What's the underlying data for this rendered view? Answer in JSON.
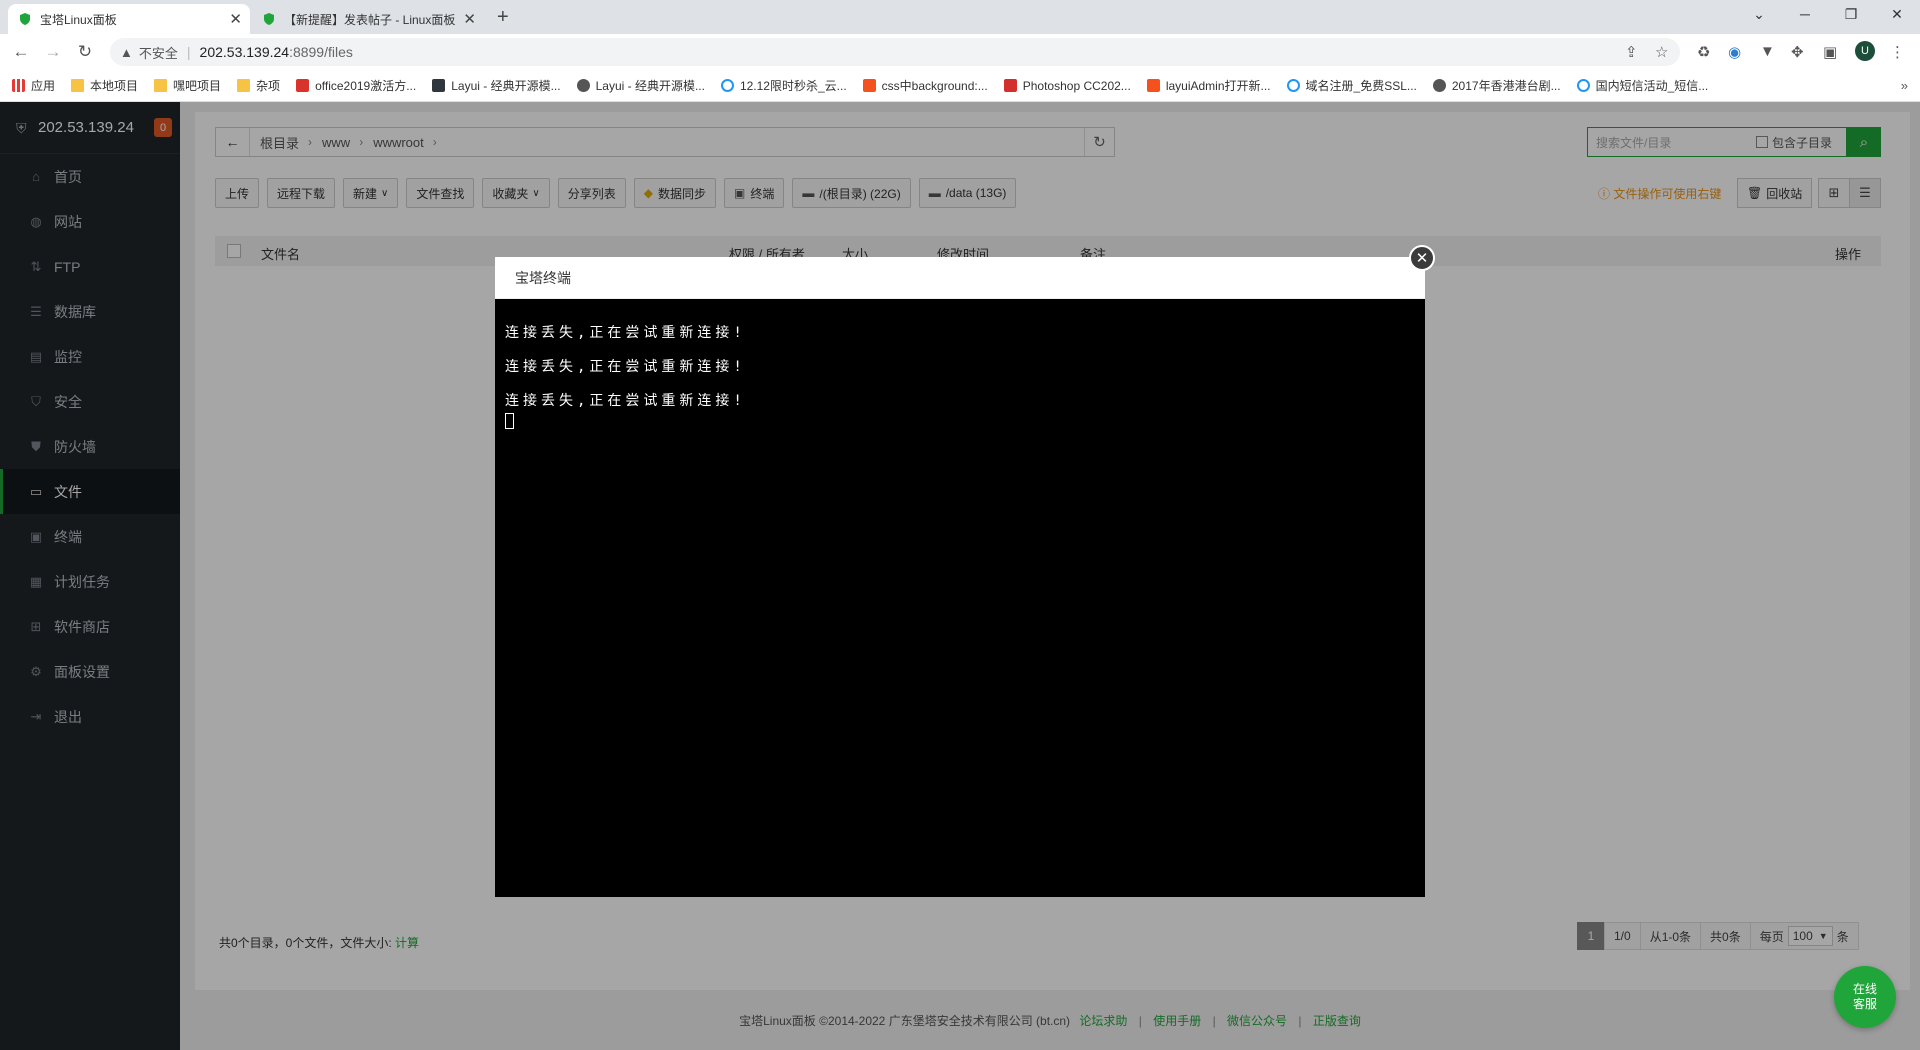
{
  "browser": {
    "tabs": [
      {
        "title": "宝塔Linux面板",
        "active": true
      },
      {
        "title": "【新提醒】发表帖子 - Linux面板",
        "active": false
      }
    ],
    "address": {
      "security_label": "不安全",
      "host": "202.53.139.24",
      "path": ":8899/files"
    },
    "avatar_letter": "U",
    "bookmarks": [
      "应用",
      "本地项目",
      "嘿吧项目",
      "杂项",
      "office2019激活方...",
      "Layui - 经典开源模...",
      "Layui - 经典开源模...",
      "12.12限时秒杀_云...",
      "css中background:...",
      "Photoshop CC202...",
      "layuiAdmin打开新...",
      "域名注册_免费SSL...",
      "2017年香港港台剧...",
      "国内短信活动_短信..."
    ]
  },
  "sidebar": {
    "server_ip": "202.53.139.24",
    "badge_count": "0",
    "items": [
      {
        "label": "首页",
        "icon": "home-icon"
      },
      {
        "label": "网站",
        "icon": "globe-icon"
      },
      {
        "label": "FTP",
        "icon": "ftp-icon"
      },
      {
        "label": "数据库",
        "icon": "database-icon"
      },
      {
        "label": "监控",
        "icon": "monitor-icon"
      },
      {
        "label": "安全",
        "icon": "shield-icon"
      },
      {
        "label": "防火墙",
        "icon": "firewall-icon"
      },
      {
        "label": "文件",
        "icon": "folder-icon",
        "active": true
      },
      {
        "label": "终端",
        "icon": "terminal-icon"
      },
      {
        "label": "计划任务",
        "icon": "calendar-icon"
      },
      {
        "label": "软件商店",
        "icon": "apps-icon"
      },
      {
        "label": "面板设置",
        "icon": "gear-icon"
      },
      {
        "label": "退出",
        "icon": "logout-icon"
      }
    ]
  },
  "files": {
    "breadcrumb": [
      "根目录",
      "www",
      "wwwroot"
    ],
    "search_placeholder": "搜索文件/目录",
    "include_subdirs_label": "包含子目录",
    "toolbar": [
      "上传",
      "远程下载",
      "新建",
      "文件查找",
      "收藏夹",
      "分享列表",
      "数据同步",
      "终端",
      "/(根目录) (22G)",
      "/data (13G)"
    ],
    "tip": "文件操作可使用右键",
    "recycle_label": "回收站",
    "columns": {
      "name": "文件名",
      "perm": "权限 / 所有者",
      "size": "大小",
      "mtime": "修改时间",
      "note": "备注",
      "ops": "操作"
    },
    "stat_text": "共0个目录，0个文件，文件大小:",
    "calc_label": "计算",
    "pager": {
      "current": "1",
      "pages": "1/0",
      "range": "从1-0条",
      "total": "共0条",
      "per_page_label": "每页",
      "per_page_value": "100",
      "unit": "条"
    }
  },
  "footer": {
    "copyright": "宝塔Linux面板 ©2014-2022 广东堡塔安全技术有限公司 (bt.cn)",
    "links": [
      "论坛求助",
      "使用手册",
      "微信公众号",
      "正版查询"
    ]
  },
  "chat_label_1": "在线",
  "chat_label_2": "客服",
  "terminal": {
    "title": "宝塔终端",
    "lines": [
      "连接丢失,正在尝试重新连接!",
      "连接丢失,正在尝试重新连接!",
      "连接丢失,正在尝试重新连接!"
    ]
  },
  "colors": {
    "accent": "#20a53a",
    "sidebar_bg": "#20252a",
    "badge": "#e05a25",
    "tip": "#e8941a"
  }
}
